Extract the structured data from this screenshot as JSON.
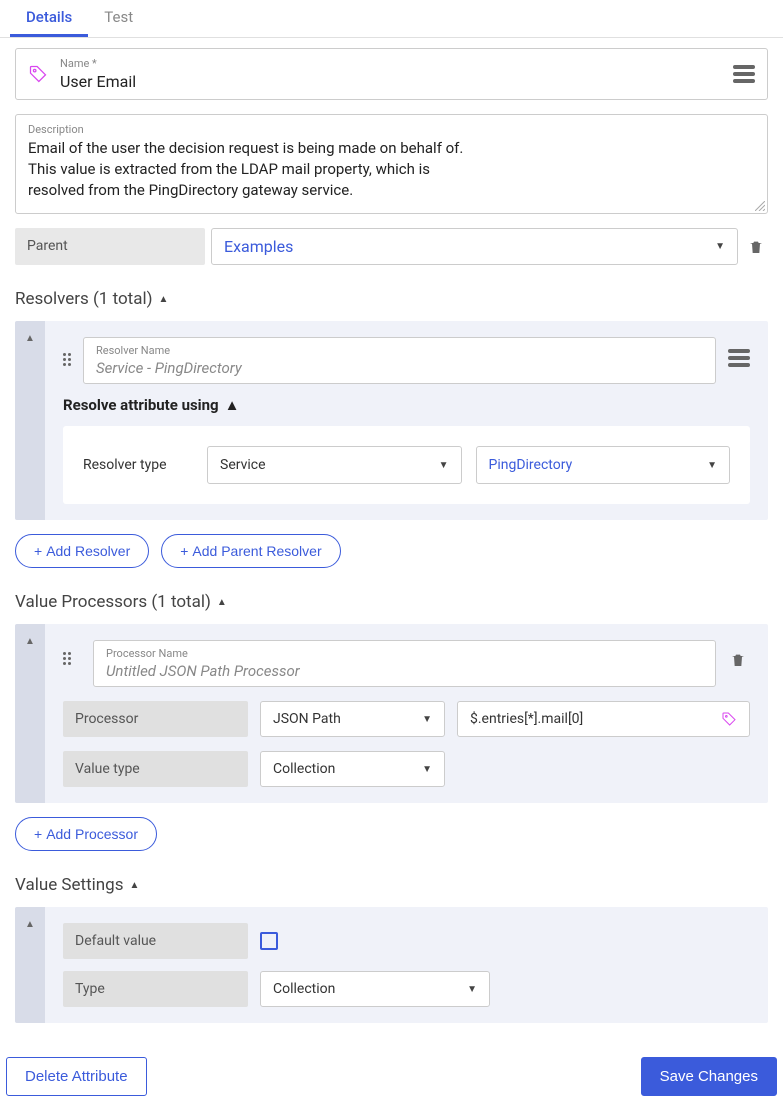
{
  "tabs": {
    "details": "Details",
    "test": "Test"
  },
  "name": {
    "label": "Name  *",
    "value": "User Email"
  },
  "description": {
    "label": "Description",
    "value": "Email of the user the decision request is being made on behalf of.\nThis value is extracted from the LDAP mail property, which is\nresolved from the PingDirectory gateway service."
  },
  "parent": {
    "label": "Parent",
    "value": "Examples"
  },
  "sections": {
    "resolvers": "Resolvers (1 total)",
    "valueProcessors": "Value Processors (1 total)",
    "valueSettings": "Value Settings"
  },
  "resolver": {
    "nameLabel": "Resolver Name",
    "nameValue": "Service - PingDirectory",
    "resolveUsing": "Resolve attribute using",
    "resolverTypeLabel": "Resolver type",
    "resolverTypeValue": "Service",
    "serviceValue": "PingDirectory"
  },
  "buttons": {
    "addResolver": "Add Resolver",
    "addParentResolver": "Add Parent Resolver",
    "addProcessor": "Add Processor",
    "delete": "Delete Attribute",
    "save": "Save Changes"
  },
  "processor": {
    "nameLabel": "Processor Name",
    "nameValue": "Untitled JSON Path Processor",
    "processorLabel": "Processor",
    "processorValue": "JSON Path",
    "expression": "$.entries[*].mail[0]",
    "valueTypeLabel": "Value type",
    "valueTypeValue": "Collection"
  },
  "valueSettings": {
    "defaultLabel": "Default value",
    "typeLabel": "Type",
    "typeValue": "Collection"
  }
}
